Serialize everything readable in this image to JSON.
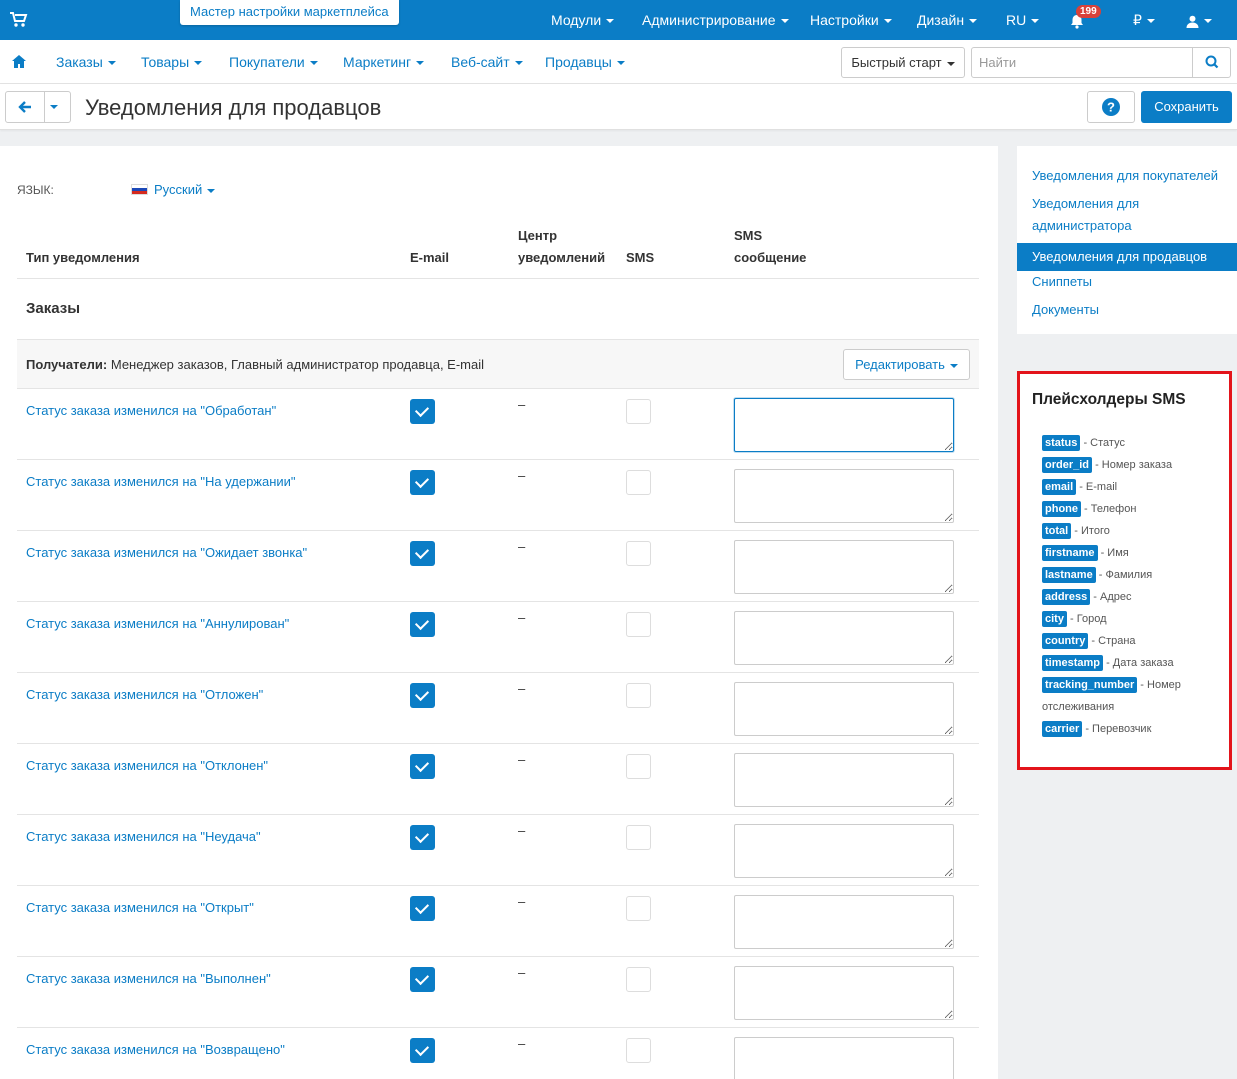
{
  "topbar": {
    "wizard": "Мастер настройки маркетплейса",
    "nav": [
      "Модули",
      "Администрирование",
      "Настройки",
      "Дизайн",
      "RU",
      "₽"
    ],
    "notifications_count": "199",
    "icons": [
      "cart-icon",
      "bell-icon",
      "user-icon"
    ]
  },
  "menubar": {
    "items": [
      "Заказы",
      "Товары",
      "Покупатели",
      "Маркетинг",
      "Веб-сайт",
      "Продавцы"
    ],
    "quick_start": "Быстрый старт",
    "search_placeholder": "Найти"
  },
  "page": {
    "title": "Уведомления для продавцов",
    "save_label": "Сохранить"
  },
  "language": {
    "label": "ЯЗЫК:",
    "value": "Русский"
  },
  "table": {
    "headers": {
      "type": "Тип уведомления",
      "email": "E-mail",
      "center_1": "Центр",
      "center_2": "уведомлений",
      "sms": "SMS",
      "sms_msg_1": "SMS",
      "sms_msg_2": "сообщение"
    },
    "section": "Заказы",
    "recipients_label": "Получатели:",
    "recipients_value": " Менеджер заказов, Главный администратор продавца, E-mail",
    "edit_label": "Редактировать",
    "rows": [
      {
        "label": "Статус заказа изменился на \"Обработан\"",
        "center": "–"
      },
      {
        "label": "Статус заказа изменился на \"На удержании\"",
        "center": "–"
      },
      {
        "label": "Статус заказа изменился на \"Ожидает звонка\"",
        "center": "–"
      },
      {
        "label": "Статус заказа изменился на \"Аннулирован\"",
        "center": "–"
      },
      {
        "label": "Статус заказа изменился на \"Отложен\"",
        "center": "–"
      },
      {
        "label": "Статус заказа изменился на \"Отклонен\"",
        "center": "–"
      },
      {
        "label": "Статус заказа изменился на \"Неудача\"",
        "center": "–"
      },
      {
        "label": "Статус заказа изменился на \"Открыт\"",
        "center": "–"
      },
      {
        "label": "Статус заказа изменился на \"Выполнен\"",
        "center": "–"
      },
      {
        "label": "Статус заказа изменился на \"Возвращено\"",
        "center": "–"
      }
    ]
  },
  "sidenav": {
    "items": [
      "Уведомления для покупателей",
      "Уведомления для",
      "администратора",
      "Уведомления для продавцов",
      "Сниппеты",
      "Документы"
    ]
  },
  "placeholders": {
    "title": "Плейсхолдеры SMS",
    "items": [
      {
        "tag": "status",
        "desc": " - Статус"
      },
      {
        "tag": "order_id",
        "desc": " - Номер заказа"
      },
      {
        "tag": "email",
        "desc": " - E-mail"
      },
      {
        "tag": "phone",
        "desc": " - Телефон"
      },
      {
        "tag": "total",
        "desc": " - Итого"
      },
      {
        "tag": "firstname",
        "desc": " - Имя"
      },
      {
        "tag": "lastname",
        "desc": " - Фамилия"
      },
      {
        "tag": "address",
        "desc": " - Адрес"
      },
      {
        "tag": "city",
        "desc": " - Город"
      },
      {
        "tag": "country",
        "desc": " - Страна"
      },
      {
        "tag": "timestamp",
        "desc": " - Дата заказа"
      },
      {
        "tag": "tracking_number",
        "desc": " - Номер"
      },
      {
        "tag": "carrier",
        "desc": " - Перевозчик"
      }
    ],
    "wrap_text": "отслеживания"
  },
  "colors": {
    "accent": "#0b7dc6",
    "highlight_border": "#e3141b"
  }
}
